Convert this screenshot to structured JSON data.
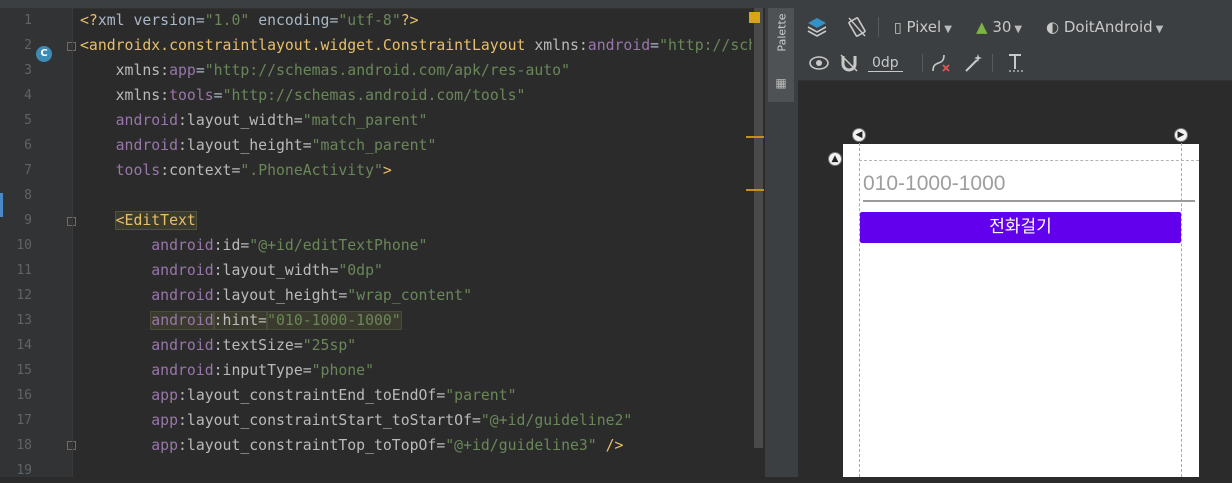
{
  "gutter": {
    "line_numbers": [
      "1",
      "2",
      "3",
      "4",
      "5",
      "6",
      "7",
      "8",
      "9",
      "10",
      "11",
      "12",
      "13",
      "14",
      "15",
      "16",
      "17",
      "18",
      "19"
    ],
    "class_marker": "C"
  },
  "editor": {
    "lines": [
      [
        {
          "t": "<?",
          "c": "dec"
        },
        {
          "t": "xml version=",
          "c": "tx"
        },
        {
          "t": "\"1.0\"",
          "c": "str"
        },
        {
          "t": " encoding=",
          "c": "tx"
        },
        {
          "t": "\"utf-8\"",
          "c": "str"
        },
        {
          "t": "?>",
          "c": "dec"
        }
      ],
      [
        {
          "t": "<androidx.constraintlayout.widget.ConstraintLayout ",
          "c": "tag"
        },
        {
          "t": "xmlns:",
          "c": "attr"
        },
        {
          "t": "android",
          "c": "ns"
        },
        {
          "t": "=",
          "c": "tx"
        },
        {
          "t": "\"http://schemas",
          "c": "str"
        }
      ],
      [
        {
          "t": "    xmlns:",
          "c": "attr"
        },
        {
          "t": "app",
          "c": "ns"
        },
        {
          "t": "=",
          "c": "tx"
        },
        {
          "t": "\"http://schemas.android.com/apk/res-auto\"",
          "c": "str"
        }
      ],
      [
        {
          "t": "    xmlns:",
          "c": "attr"
        },
        {
          "t": "tools",
          "c": "ns"
        },
        {
          "t": "=",
          "c": "tx"
        },
        {
          "t": "\"http://schemas.android.com/tools\"",
          "c": "str"
        }
      ],
      [
        {
          "t": "    android",
          "c": "ns"
        },
        {
          "t": ":layout_width=",
          "c": "attr"
        },
        {
          "t": "\"match_parent\"",
          "c": "str"
        }
      ],
      [
        {
          "t": "    android",
          "c": "ns"
        },
        {
          "t": ":layout_height=",
          "c": "attr"
        },
        {
          "t": "\"match_parent\"",
          "c": "str"
        }
      ],
      [
        {
          "t": "    tools",
          "c": "ns"
        },
        {
          "t": ":context=",
          "c": "attr"
        },
        {
          "t": "\".PhoneActivity\"",
          "c": "str"
        },
        {
          "t": ">",
          "c": "tag"
        }
      ],
      [],
      [
        {
          "t": "    ",
          "c": "tx"
        },
        {
          "t": "<EditText",
          "c": "tag",
          "box": true
        }
      ],
      [
        {
          "t": "        android",
          "c": "ns"
        },
        {
          "t": ":id=",
          "c": "attr"
        },
        {
          "t": "\"@+id/editTextPhone\"",
          "c": "str"
        }
      ],
      [
        {
          "t": "        android",
          "c": "ns"
        },
        {
          "t": ":layout_width=",
          "c": "attr"
        },
        {
          "t": "\"0dp\"",
          "c": "str"
        }
      ],
      [
        {
          "t": "        android",
          "c": "ns"
        },
        {
          "t": ":layout_height=",
          "c": "attr"
        },
        {
          "t": "\"wrap_content\"",
          "c": "str"
        }
      ],
      [
        {
          "t": "        ",
          "c": "tx"
        },
        {
          "t": "android",
          "c": "ns",
          "hl": true
        },
        {
          "t": ":hint=",
          "c": "attr",
          "hl": true
        },
        {
          "t": "\"010-1000-1000\"",
          "c": "str",
          "hl": true
        }
      ],
      [
        {
          "t": "        android",
          "c": "ns"
        },
        {
          "t": ":textSize=",
          "c": "attr"
        },
        {
          "t": "\"25sp\"",
          "c": "str"
        }
      ],
      [
        {
          "t": "        android",
          "c": "ns"
        },
        {
          "t": ":inputType=",
          "c": "attr"
        },
        {
          "t": "\"phone\"",
          "c": "str"
        }
      ],
      [
        {
          "t": "        app",
          "c": "ns"
        },
        {
          "t": ":layout_constraintEnd_toEndOf=",
          "c": "attr"
        },
        {
          "t": "\"parent\"",
          "c": "str"
        }
      ],
      [
        {
          "t": "        app",
          "c": "ns"
        },
        {
          "t": ":layout_constraintStart_toStartOf=",
          "c": "attr"
        },
        {
          "t": "\"@+id/guideline2\"",
          "c": "str"
        }
      ],
      [
        {
          "t": "        app",
          "c": "ns"
        },
        {
          "t": ":layout_constraintTop_toTopOf=",
          "c": "attr"
        },
        {
          "t": "\"@+id/guideline3\"",
          "c": "str"
        },
        {
          "t": " />",
          "c": "tag"
        }
      ],
      []
    ]
  },
  "palette": {
    "label": "Palette"
  },
  "designer": {
    "toolbar": {
      "device": "Pixel",
      "api_level": "30",
      "theme": "DoitAndroid",
      "margin_value": "0dp"
    },
    "preview": {
      "hint_text": "010-1000-1000",
      "button_label": "전화걸기",
      "button_color": "#6200ee"
    }
  },
  "colors": {
    "editor_bg": "#2b2b2b",
    "gutter_bg": "#313335",
    "tag": "#e8bf6a",
    "namespace": "#9876aa",
    "string": "#6a8759"
  }
}
